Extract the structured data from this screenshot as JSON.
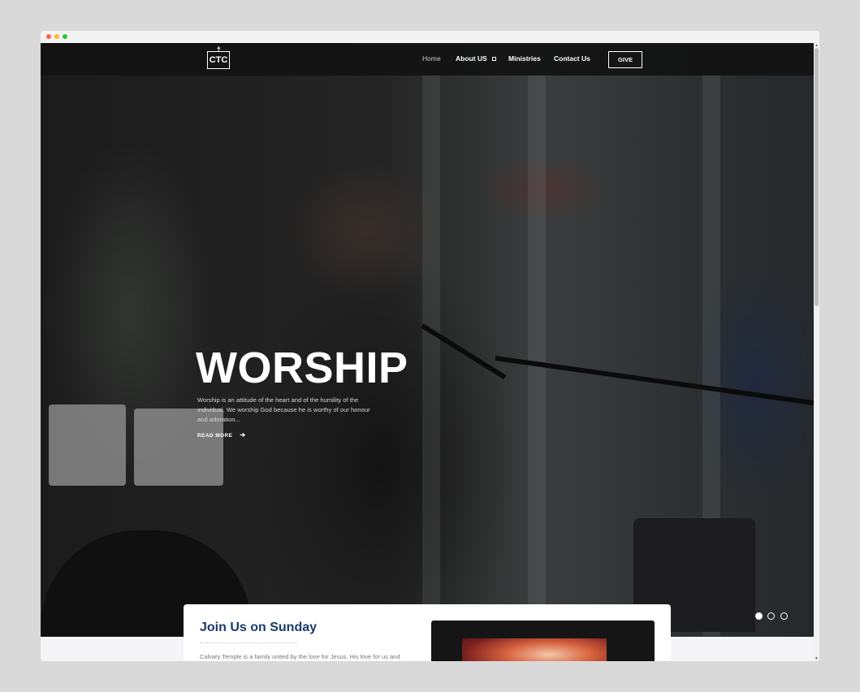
{
  "nav": {
    "logo_text": "CTC",
    "items": [
      {
        "label": "Home",
        "active": true
      },
      {
        "label": "About US",
        "has_dropdown": true
      },
      {
        "label": "Ministries"
      },
      {
        "label": "Contact Us"
      }
    ],
    "give_label": "GIVE"
  },
  "hero": {
    "title": "WORSHIP",
    "text": "Worship is an attitude of the heart and of the humility of the individual. We worship God because he is worthy of our honour and adoration...",
    "read_more": "READ MORE",
    "slides_count": 3,
    "active_slide": 1
  },
  "section": {
    "title": "Join Us on Sunday",
    "text": "Calvary Temple is a family united by the love for Jesus, His love for us and"
  },
  "colors": {
    "heading": "#1a3a6b",
    "navbar_bg": "#121212",
    "page_bg": "#d9d9d9"
  },
  "icons": {
    "read_more": "arrow-right-icon",
    "dropdown": "caret-square-icon"
  }
}
